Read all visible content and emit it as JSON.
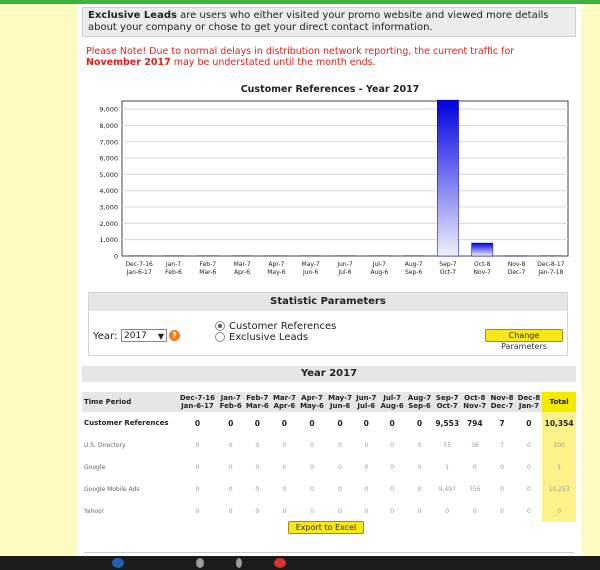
{
  "intro": {
    "bold": "Exclusive Leads",
    "text": " are users who either visited your promo website and viewed more details about your company or chose to get your direct contact information."
  },
  "note": {
    "prefix": "Please Note! Due to normal delays in distribution network reporting, the current traffic for ",
    "highlight": "November 2017",
    "suffix": " may be understated until the month ends."
  },
  "chart_data": {
    "type": "bar",
    "title": "Customer References - Year 2017",
    "xlabel": "",
    "ylabel": "",
    "ylim": [
      0,
      9500
    ],
    "yticks": [
      0,
      "1,000",
      "2,000",
      "3,000",
      "4,000",
      "5,000",
      "6,000",
      "7,000",
      "8,000",
      "9,000"
    ],
    "categories": [
      [
        "Dec-7-16",
        "Jan-6-17"
      ],
      [
        "Jan-7",
        "Feb-6"
      ],
      [
        "Feb-7",
        "Mar-6"
      ],
      [
        "Mar-7",
        "Apr-6"
      ],
      [
        "Apr-7",
        "May-6"
      ],
      [
        "May-7",
        "Jun-6"
      ],
      [
        "Jun-7",
        "Jul-6"
      ],
      [
        "Jul-7",
        "Aug-6"
      ],
      [
        "Aug-7",
        "Sep-6"
      ],
      [
        "Sep-7",
        "Oct-7"
      ],
      [
        "Oct-8",
        "Nov-7"
      ],
      [
        "Nov-8",
        "Dec-7"
      ],
      [
        "Dec-8-17",
        "Jan-7-18"
      ]
    ],
    "values": [
      0,
      0,
      0,
      0,
      0,
      0,
      0,
      0,
      0,
      9553,
      794,
      7,
      0
    ],
    "grid": true,
    "bar_color": "#0000e0"
  },
  "params": {
    "header": "Statistic Parameters",
    "year_label": "Year:",
    "year_value": "2017",
    "radio_1": "Customer References",
    "radio_2": "Exclusive Leads",
    "change_button": "Change Parameters"
  },
  "table": {
    "year_title": "Year 2017",
    "headers": [
      [
        "Time Period",
        ""
      ],
      [
        "Dec-7-16",
        "Jan-6-17"
      ],
      [
        "Jan-7",
        "Feb-6"
      ],
      [
        "Feb-7",
        "Mar-6"
      ],
      [
        "Mar-7",
        "Apr-6"
      ],
      [
        "Apr-7",
        "May-6"
      ],
      [
        "May-7",
        "Jun-6"
      ],
      [
        "Jun-7",
        "Jul-6"
      ],
      [
        "Jul-7",
        "Aug-6"
      ],
      [
        "Aug-7",
        "Sep-6"
      ],
      [
        "Sep-7",
        "Oct-7"
      ],
      [
        "Oct-8",
        "Nov-7"
      ],
      [
        "Nov-8",
        "Dec-7"
      ],
      [
        "Dec-8",
        "Jan-7"
      ],
      [
        "Total",
        ""
      ]
    ],
    "rows": [
      {
        "label": "Customer References",
        "cells": [
          "0",
          "0",
          "0",
          "0",
          "0",
          "0",
          "0",
          "0",
          "0",
          "9,553",
          "794",
          "7",
          "0",
          "10,354"
        ],
        "main": true
      },
      {
        "label": "U.S. Directory",
        "cells": [
          "0",
          "0",
          "0",
          "0",
          "0",
          "0",
          "0",
          "0",
          "0",
          "55",
          "38",
          "7",
          "0",
          "100"
        ],
        "main": false
      },
      {
        "label": "Google",
        "cells": [
          "0",
          "0",
          "0",
          "0",
          "0",
          "0",
          "0",
          "0",
          "0",
          "1",
          "0",
          "0",
          "0",
          "1"
        ],
        "main": false
      },
      {
        "label": "Google Mobile Ads",
        "cells": [
          "0",
          "0",
          "0",
          "0",
          "0",
          "0",
          "0",
          "0",
          "0",
          "9,497",
          "756",
          "0",
          "0",
          "10,253"
        ],
        "main": false
      },
      {
        "label": "Yahoo!",
        "cells": [
          "0",
          "0",
          "0",
          "0",
          "0",
          "0",
          "0",
          "0",
          "0",
          "0",
          "0",
          "0",
          "0",
          "0"
        ],
        "main": false
      }
    ],
    "export_button": "Export to Excel"
  },
  "colors": {
    "background": "#fdfbc0",
    "accent_green": "#3db33d",
    "note_red": "#e0201a",
    "button_yellow": "#f8e818"
  }
}
